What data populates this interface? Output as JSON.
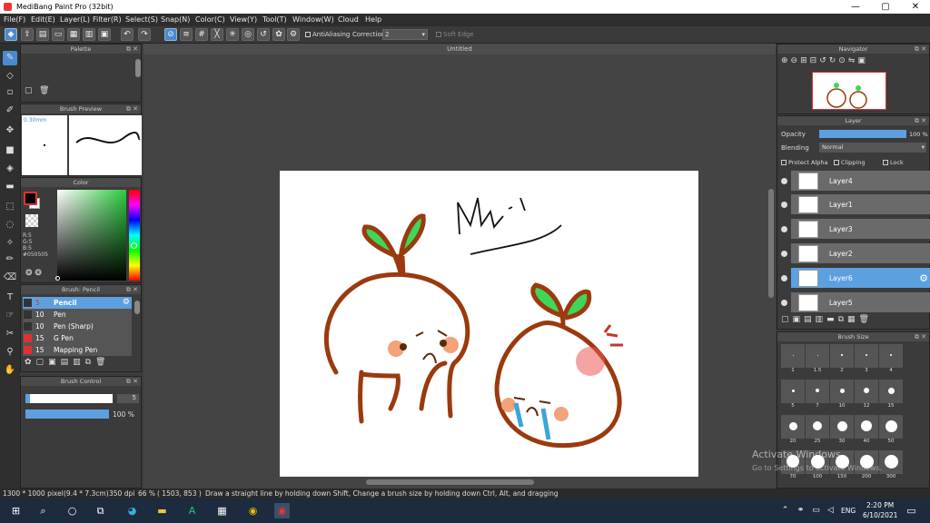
{
  "window": {
    "title": "MediBang Paint Pro (32bit)",
    "min": "—",
    "max": "▢",
    "close": "✕"
  },
  "menu": [
    "File(F)",
    "Edit(E)",
    "Layer(L)",
    "Filter(R)",
    "Select(S)",
    "Snap(N)",
    "Color(C)",
    "View(Y)",
    "Tool(T)",
    "Window(W)",
    "Cloud",
    "Help"
  ],
  "toolbar": {
    "antialias": "AntiAliasing",
    "correction_label": "Correction",
    "correction_value": "2",
    "softedge": "Soft Edge"
  },
  "panels": {
    "palette": "Palette",
    "brush_preview": "Brush Preview",
    "brush_preview_size": "0.30mm",
    "color": "Color",
    "color_r": "R:5",
    "color_g": "G:5",
    "color_b": "B:5",
    "color_hex": "#050505",
    "brush_list": "Brush: Pencil",
    "brush_control": "Brush Control",
    "navigator": "Navigator",
    "layer": "Layer",
    "brush_size": "Brush Size"
  },
  "brushes": [
    {
      "size": "5",
      "name": "Pencil",
      "color": "#333333"
    },
    {
      "size": "10",
      "name": "Pen",
      "color": "#333333"
    },
    {
      "size": "10",
      "name": "Pen (Sharp)",
      "color": "#333333"
    },
    {
      "size": "15",
      "name": "G Pen",
      "color": "#e03030"
    },
    {
      "size": "15",
      "name": "Mapping Pen",
      "color": "#e03030"
    }
  ],
  "brush_control": {
    "size": "5",
    "opacity": "100 %",
    "size_fraction": 0.05,
    "opacity_fraction": 1.0
  },
  "canvas": {
    "title": "Untitled",
    "signature": "Mwn'j"
  },
  "layer_panel": {
    "opacity_label": "Opacity",
    "opacity_value": "100 %",
    "opacity_fraction": 1.0,
    "blending_label": "Blending",
    "blending_value": "Normal",
    "protect_alpha": "Protect Alpha",
    "clipping": "Clipping",
    "lock": "Lock",
    "layers": [
      {
        "name": "Layer4",
        "selected": false
      },
      {
        "name": "Layer1",
        "selected": false
      },
      {
        "name": "Layer3",
        "selected": false
      },
      {
        "name": "Layer2",
        "selected": false
      },
      {
        "name": "Layer6",
        "selected": true
      },
      {
        "name": "Layer5",
        "selected": false
      }
    ]
  },
  "brush_sizes": [
    "1",
    "1.5",
    "2",
    "3",
    "4",
    "5",
    "7",
    "10",
    "12",
    "15",
    "20",
    "25",
    "30",
    "40",
    "50",
    "70",
    "100",
    "150",
    "200",
    "300"
  ],
  "status": {
    "dimensions": "1300 * 1000 pixel",
    "physical": "(9.4 * 7.3cm)",
    "dpi": "350 dpi",
    "zoom": "66 %",
    "cursor": "( 1503, 853 )",
    "hint": "Draw a straight line by holding down Shift, Change a brush size by holding down Ctrl, Alt, and dragging"
  },
  "watermark": {
    "line1": "Activate Windows",
    "line2": "Go to Settings to activate Windows."
  },
  "taskbar": {
    "lang": "ENG",
    "time": "2:20 PM",
    "date": "6/10/2021"
  }
}
